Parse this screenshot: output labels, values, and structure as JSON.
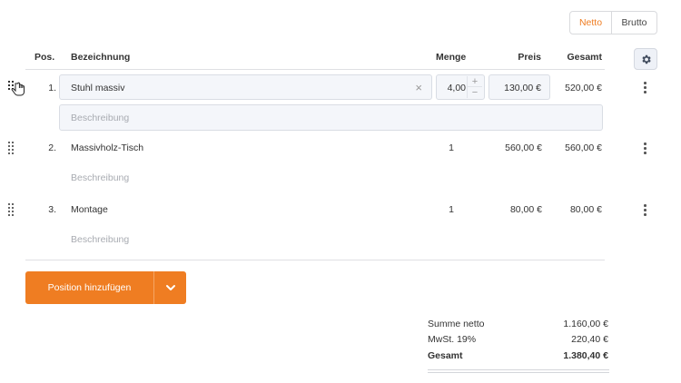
{
  "price_mode": {
    "netto": "Netto",
    "brutto": "Brutto",
    "active": "Netto"
  },
  "columns": {
    "pos": "Pos.",
    "name": "Bezeichnung",
    "qty": "Menge",
    "price": "Preis",
    "total": "Gesamt"
  },
  "icons": {
    "drag": "drag-handle-icon",
    "hand": "hand-cursor-icon",
    "settings": "gear-icon",
    "clear": "clear-icon",
    "more": "more-vertical-icon",
    "chevron": "chevron-down-icon"
  },
  "accent_color": "#ef7d22",
  "items": [
    {
      "pos": "1.",
      "name": "Stuhl massiv",
      "qty": "4,00",
      "price": "130,00 €",
      "total": "520,00 €",
      "description_placeholder": "Beschreibung",
      "editing": true
    },
    {
      "pos": "2.",
      "name": "Massivholz-Tisch",
      "qty": "1",
      "price": "560,00 €",
      "total": "560,00 €",
      "description_placeholder": "Beschreibung"
    },
    {
      "pos": "3.",
      "name": "Montage",
      "qty": "1",
      "price": "80,00 €",
      "total": "80,00 €",
      "description_placeholder": "Beschreibung"
    }
  ],
  "stepper": {
    "up": "+",
    "down": "−"
  },
  "clear_symbol": "×",
  "add_button": {
    "label": "Position hinzufügen"
  },
  "summary": {
    "net_label": "Summe netto",
    "net_value": "1.160,00 €",
    "vat_label": "MwSt. 19%",
    "vat_value": "220,40 €",
    "total_label": "Gesamt",
    "total_value": "1.380,40 €"
  }
}
